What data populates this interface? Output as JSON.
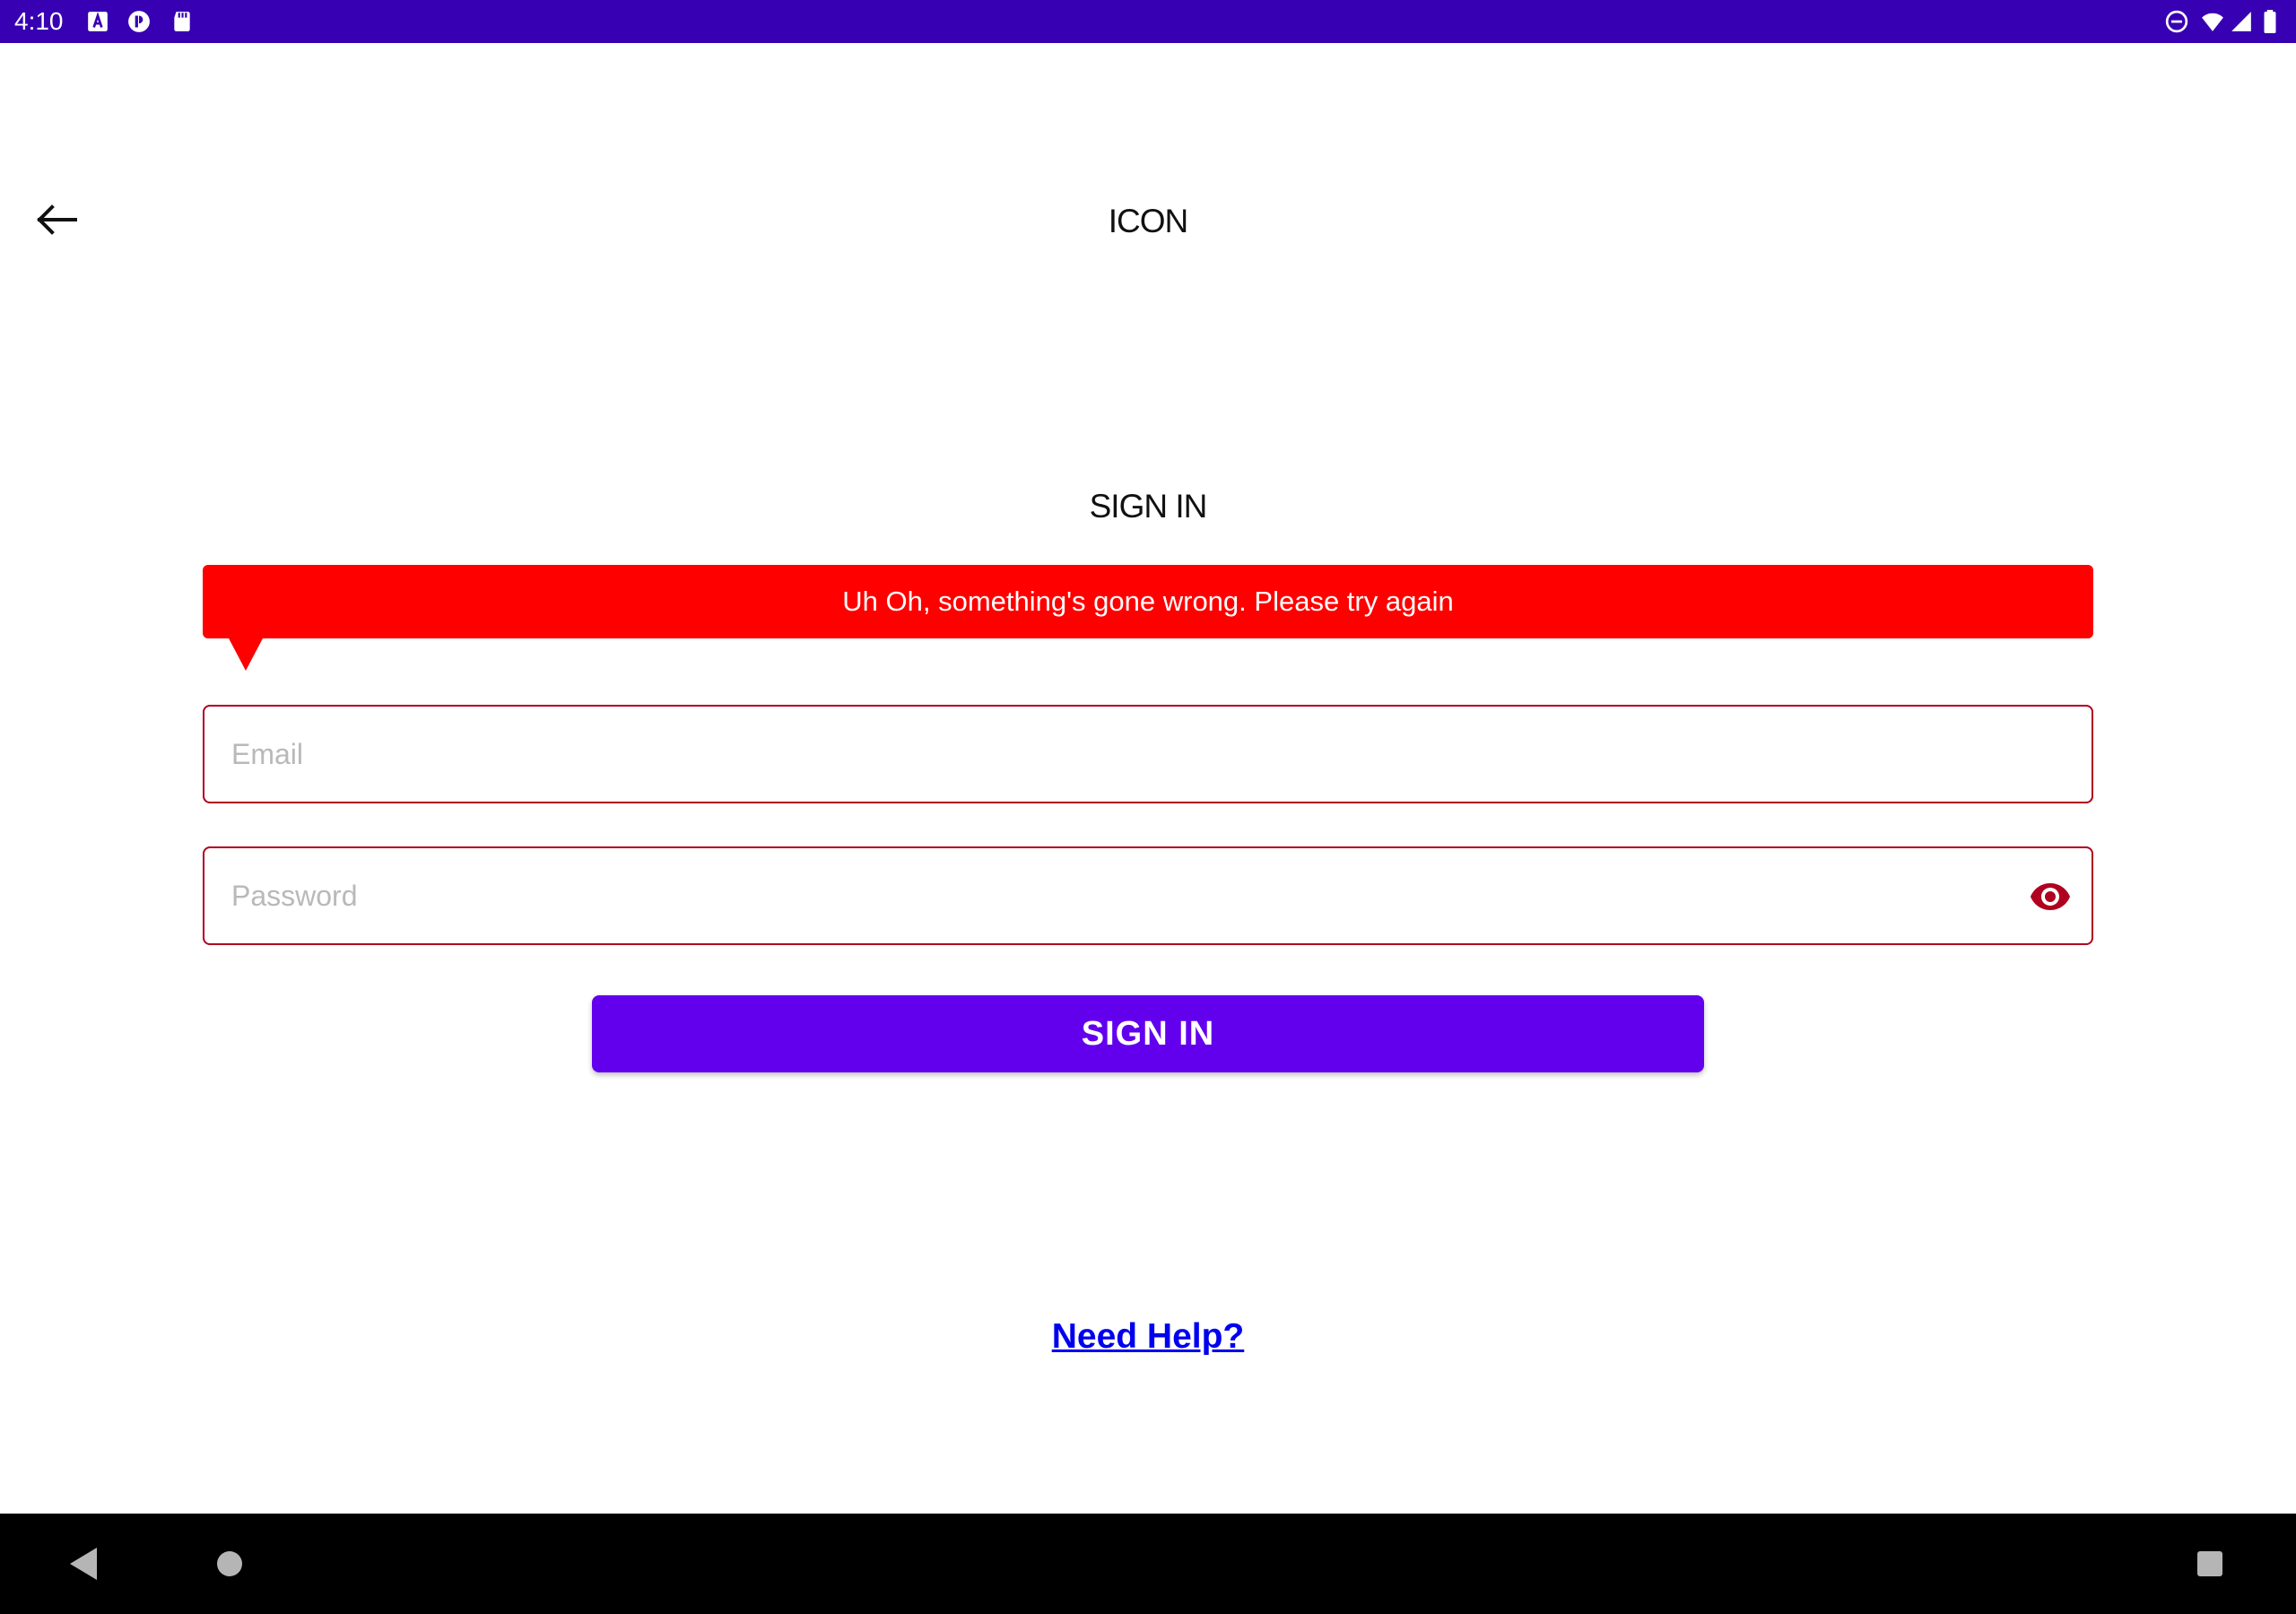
{
  "status_bar": {
    "time": "4:10",
    "left_icons": [
      "text-a-icon",
      "circle-p-icon",
      "sd-card-icon"
    ],
    "right_icons": [
      "do-not-disturb-icon",
      "wifi-icon",
      "cell-signal-icon",
      "battery-icon"
    ],
    "background": "#3700b3"
  },
  "header": {
    "back_icon": "arrow-left-icon",
    "title": "ICON"
  },
  "form": {
    "heading": "SIGN IN",
    "error_message": "Uh Oh, something's gone wrong. Please try again",
    "error_color": "#ff0000",
    "email": {
      "placeholder": "Email",
      "value": ""
    },
    "password": {
      "placeholder": "Password",
      "value": "",
      "toggle_icon": "eye-icon"
    },
    "field_border_color": "#b00020",
    "submit_label": "SIGN IN",
    "submit_color": "#6200ee"
  },
  "help": {
    "label": "Need Help?",
    "color": "#0000ee"
  },
  "nav_bar": {
    "buttons": [
      "back-triangle-icon",
      "home-circle-icon",
      "recents-square-icon"
    ]
  }
}
